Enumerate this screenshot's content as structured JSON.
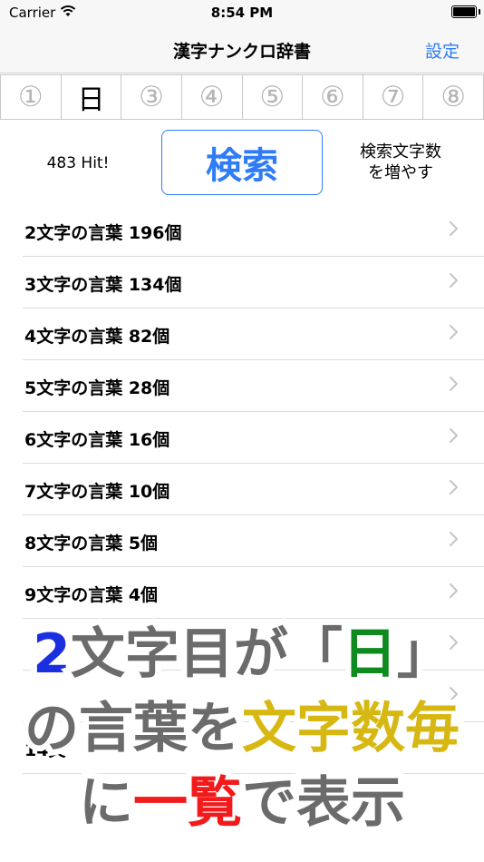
{
  "status": {
    "carrier": "Carrier",
    "time": "8:54 PM"
  },
  "nav": {
    "title": "漢字ナンクロ辞書",
    "right_button": "設定"
  },
  "char_tabs": [
    {
      "label": "①",
      "active": false
    },
    {
      "label": "日",
      "active": true
    },
    {
      "label": "③",
      "active": false
    },
    {
      "label": "④",
      "active": false
    },
    {
      "label": "⑤",
      "active": false
    },
    {
      "label": "⑥",
      "active": false
    },
    {
      "label": "⑦",
      "active": false
    },
    {
      "label": "⑧",
      "active": false
    }
  ],
  "search": {
    "hit_count": "483 Hit!",
    "button_label": "検索",
    "increase_label_1": "検索文字数",
    "increase_label_2": "を増やす"
  },
  "rows": [
    "2文字の言葉 196個",
    "3文字の言葉 134個",
    "4文字の言葉 82個",
    "5文字の言葉 28個",
    "6文字の言葉 16個",
    "7文字の言葉 10個",
    "8文字の言葉 5個",
    "9文字の言葉 4個",
    "",
    "",
    "14文"
  ],
  "overlay": {
    "line1": [
      "2",
      "文字目が「",
      "日",
      "」"
    ],
    "line2": [
      "の言葉を",
      "文字数毎"
    ],
    "line3": [
      "に",
      "一覧",
      "で表示"
    ]
  },
  "colors": {
    "accent": "#2f7cf6",
    "overlay_blue": "#1a2fe0",
    "overlay_green": "#0f8a1e",
    "overlay_gold": "#d7b812",
    "overlay_red": "#f21a1a",
    "overlay_gray": "#6b6b6b"
  }
}
